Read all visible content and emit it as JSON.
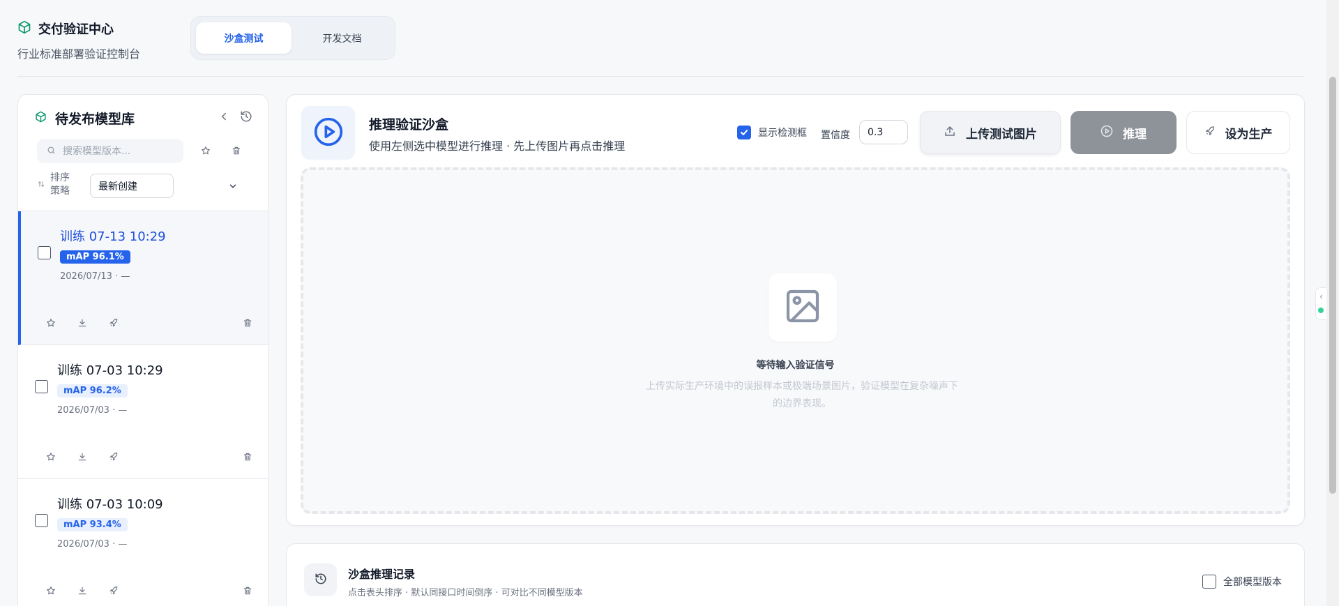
{
  "brand": {
    "title": "交付验证中心",
    "subtitle": "行业标准部署验证控制台"
  },
  "tabs": [
    {
      "label": "沙盒测试",
      "active": true
    },
    {
      "label": "开发文档",
      "active": false
    }
  ],
  "sidebar": {
    "title": "待发布模型库",
    "search_placeholder": "搜索模型版本...",
    "sort_label_line1": "排序",
    "sort_label_line2": "策略",
    "sort_value": "最新创建",
    "models": [
      {
        "title": "训练 07-13 10:29",
        "badge": "mAP 96.1%",
        "date": "2026/07/13",
        "sep": "·",
        "dash": "—",
        "selected": true
      },
      {
        "title": "训练 07-03 10:29",
        "badge": "mAP 96.2%",
        "date": "2026/07/03",
        "sep": "·",
        "dash": "—",
        "selected": false
      },
      {
        "title": "训练 07-03 10:09",
        "badge": "mAP 93.4%",
        "date": "2026/07/03",
        "sep": "·",
        "dash": "—",
        "selected": false
      }
    ]
  },
  "sandbox": {
    "title": "推理验证沙盒",
    "subtitle": "使用左侧选中模型进行推理 · 先上传图片再点击推理",
    "show_boxes_label": "显示检测框",
    "show_boxes_checked": true,
    "confidence_label": "置信度",
    "confidence_value": "0.3",
    "upload_label": "上传测试图片",
    "infer_label": "推理",
    "production_label": "设为生产",
    "drop_title": "等待输入验证信号",
    "drop_desc_line1": "上传实际生产环境中的误报样本或极端场景图片，验证模型在复杂噪声下",
    "drop_desc_line2": "的边界表现。"
  },
  "history": {
    "title": "沙盒推理记录",
    "subtitle": "点击表头排序 · 默认同接口时间倒序 · 可对比不同模型版本",
    "all_versions_label": "全部模型版本",
    "all_versions_checked": false
  },
  "colors": {
    "accent": "#2563eb",
    "infer_disabled": "#8e9299",
    "status_dot": "#34d399"
  },
  "icons": [
    "cube-icon",
    "chevron-left-icon",
    "history-icon",
    "search-icon",
    "star-icon",
    "trash-icon",
    "sort-icon",
    "chevron-down-icon",
    "download-icon",
    "rocket-icon",
    "play-circle-icon",
    "check-icon",
    "upload-icon",
    "image-icon"
  ]
}
